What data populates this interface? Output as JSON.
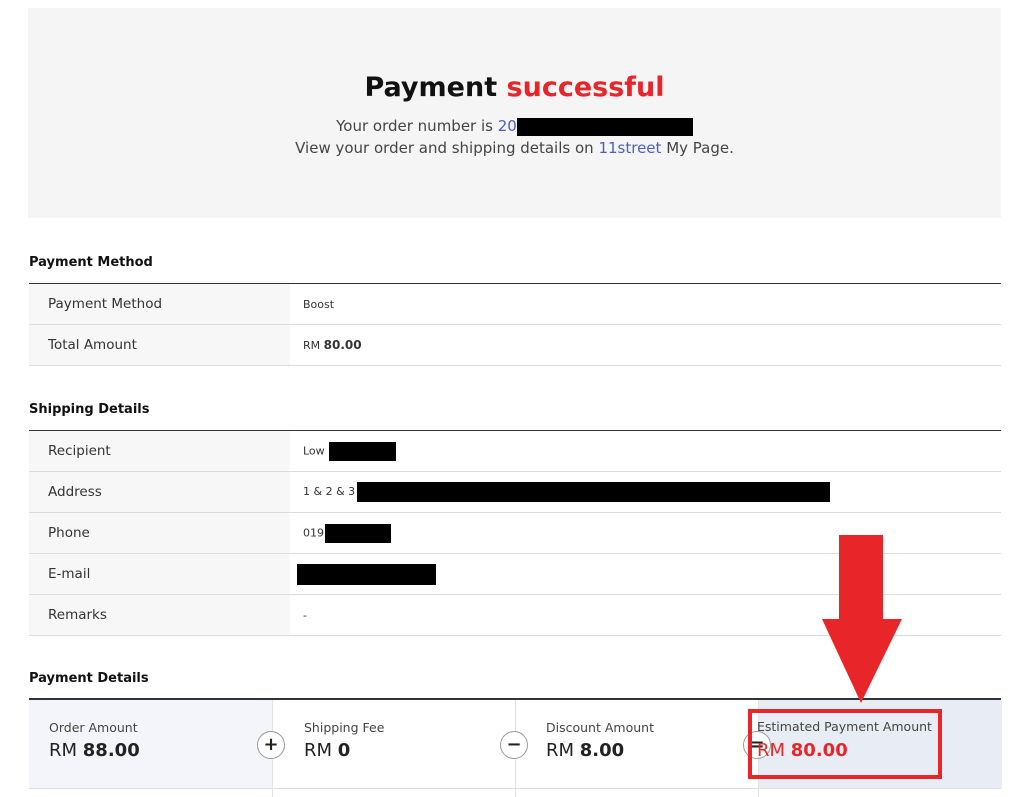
{
  "hero": {
    "title_main": "Payment",
    "title_accent": "successful",
    "order_prefix": "Your order number is",
    "order_number_visible": "20",
    "details_prefix": "View your order and shipping details on",
    "details_link": "11street",
    "details_suffix": "My Page."
  },
  "payment_method": {
    "section_title": "Payment Method",
    "rows": [
      {
        "label": "Payment Method",
        "value": "Boost"
      },
      {
        "label": "Total Amount",
        "currency": "RM",
        "amount": "80.00"
      }
    ]
  },
  "shipping": {
    "section_title": "Shipping Details",
    "rows": [
      {
        "label": "Recipient",
        "value": "Low"
      },
      {
        "label": "Address",
        "value": "1 & 2 & 3"
      },
      {
        "label": "Phone",
        "value": "019"
      },
      {
        "label": "E-mail",
        "value": ""
      },
      {
        "label": "Remarks",
        "value": "-"
      }
    ]
  },
  "payment_details": {
    "section_title": "Payment Details",
    "items": [
      {
        "label": "Order Amount",
        "currency": "RM",
        "amount": "88.00"
      },
      {
        "label": "Shipping Fee",
        "currency": "RM",
        "amount": "0"
      },
      {
        "label": "Discount Amount",
        "currency": "RM",
        "amount": "8.00"
      },
      {
        "label": "Estimated Payment Amount",
        "currency": "RM",
        "amount": "80.00"
      }
    ],
    "operators": [
      "+",
      "−",
      "="
    ]
  },
  "colors": {
    "accent": "#e8262a",
    "link": "#4a5fc1",
    "highlight_bg": "#e8ecf5"
  },
  "icons": {
    "annotation": "down-arrow-icon",
    "redaction": "redaction-bar"
  }
}
